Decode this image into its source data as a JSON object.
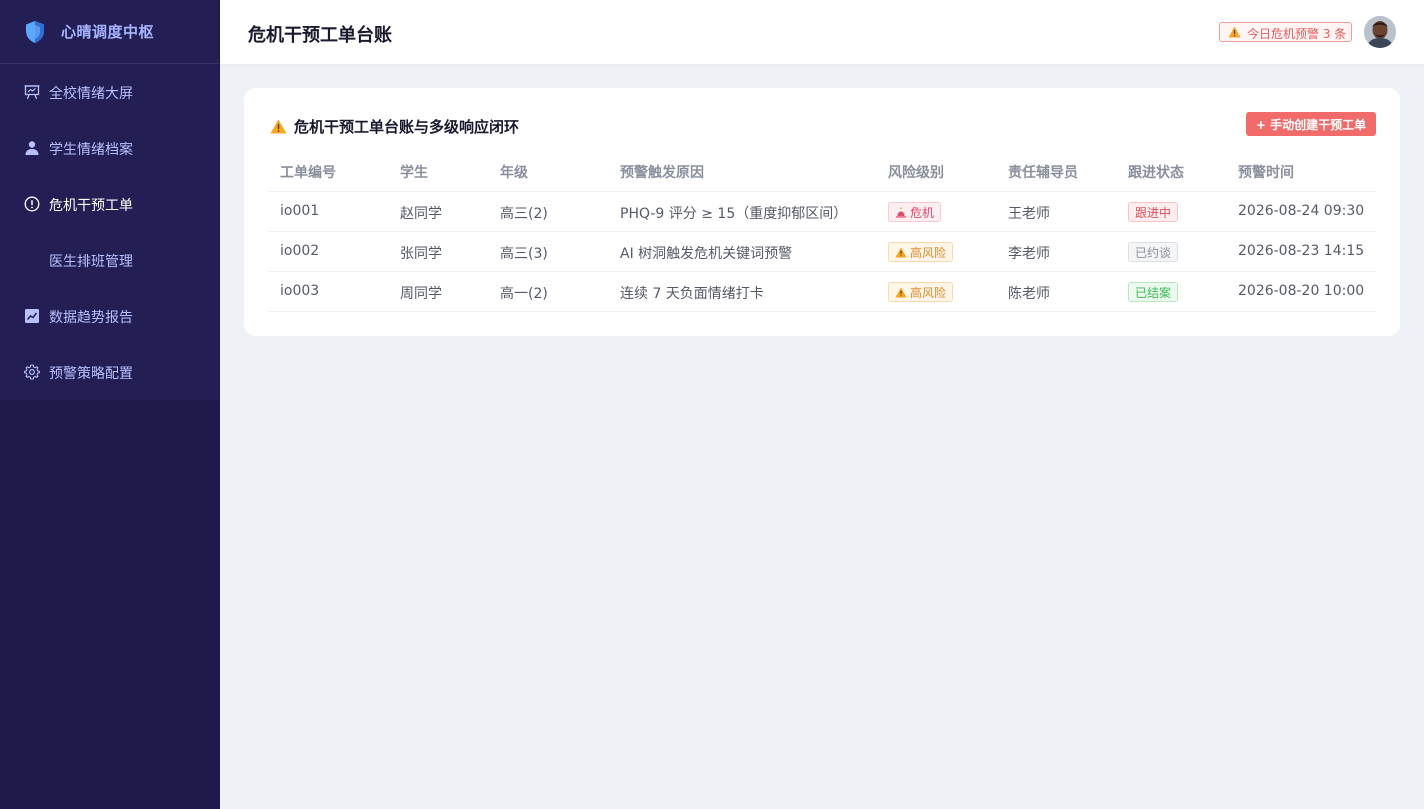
{
  "sidebar": {
    "brand": "心晴调度中枢",
    "items": [
      {
        "label": "全校情绪大屏",
        "icon": "presentation-icon"
      },
      {
        "label": "学生情绪档案",
        "icon": "user-icon"
      },
      {
        "label": "危机干预工单",
        "icon": "alert-circle-icon",
        "active": true
      },
      {
        "label": "医生排班管理",
        "icon": ""
      },
      {
        "label": "数据趋势报告",
        "icon": "trend-chart-icon"
      },
      {
        "label": "预警策略配置",
        "icon": "gear-icon"
      }
    ]
  },
  "header": {
    "title": "危机干预工单台账",
    "alert_badge": "今日危机预警 3 条"
  },
  "card": {
    "title": "危机干预工单台账与多级响应闭环",
    "create_button": "+ 手动创建干预工单",
    "columns": [
      "工单编号",
      "学生",
      "年级",
      "预警触发原因",
      "风险级别",
      "责任辅导员",
      "跟进状态",
      "预警时间"
    ],
    "rows": [
      {
        "id": "io001",
        "student": "赵同学",
        "grade": "高三(2)",
        "reason": "PHQ-9 评分 ≥ 15（重度抑郁区间）",
        "risk": "危机",
        "counselor": "王老师",
        "status": "跟进中",
        "time": "2026-08-24 09:30"
      },
      {
        "id": "io002",
        "student": "张同学",
        "grade": "高三(3)",
        "reason": "AI 树洞触发危机关键词预警",
        "risk": "高风险",
        "counselor": "李老师",
        "status": "已约谈",
        "time": "2026-08-23 14:15"
      },
      {
        "id": "io003",
        "student": "周同学",
        "grade": "高一(2)",
        "reason": "连续 7 天负面情绪打卡",
        "risk": "高风险",
        "counselor": "陈老师",
        "status": "已结案",
        "time": "2026-08-20 10:00"
      }
    ]
  },
  "colors": {
    "sidebar_bg": "#1e1a4b",
    "accent": "#f26b6b",
    "danger": "#e2476a",
    "warning": "#e08a2b",
    "success": "#3fba56"
  }
}
